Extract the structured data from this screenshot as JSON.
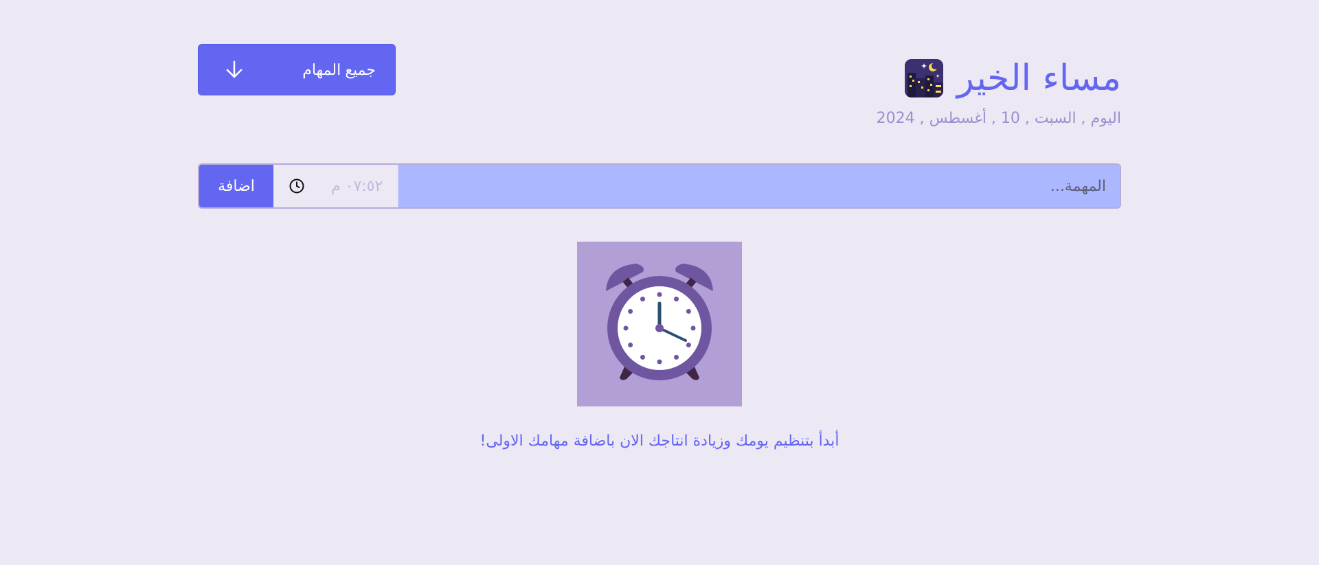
{
  "header": {
    "filter_label": "جميع المهام",
    "greeting": "مساء الخير",
    "greeting_icon": "night-city-icon",
    "date_line": "اليوم , السبت , 10 , أغسطس , 2024"
  },
  "task_form": {
    "add_label": "اضافة",
    "time_value": "٠٧:٥٢ م",
    "time_icon": "clock-icon",
    "input_placeholder": "المهمة..."
  },
  "empty_state": {
    "icon": "alarm-clock-icon",
    "message": "أبدأ بتنظيم يومك وزيادة انتاجك الان باضافة مهامك الاولى!"
  },
  "colors": {
    "background": "#ece8f4",
    "accent": "#6366f1",
    "input_bg": "#abb8ff",
    "muted": "#9c8fcf",
    "illustration_bg": "#b29fd6"
  }
}
